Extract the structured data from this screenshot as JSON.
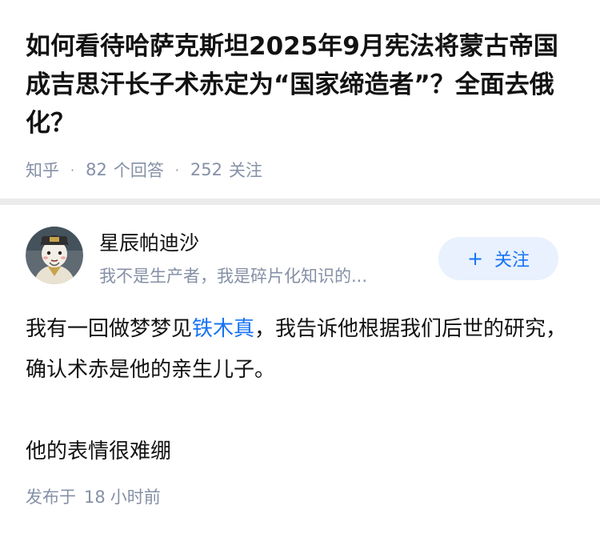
{
  "question": {
    "title": "如何看待哈萨克斯坦2025年9月宪法将蒙古帝国成吉思汗长子术赤定为“国家缔造者”？全面去俄化？",
    "source": "知乎",
    "separator": "·",
    "answers_count": "82",
    "answers_label": "个回答",
    "followers_count": "252",
    "followers_label": "关注"
  },
  "answer": {
    "author": {
      "name": "星辰帕迪沙",
      "bio": "我不是生产者，我是碎片化知识的..."
    },
    "follow_button": {
      "plus": "+",
      "label": "关注"
    },
    "content": {
      "p1_before": "我有一回做梦梦见",
      "p1_link": "铁木真",
      "p1_after": "，我告诉他根据我们后世的研究，确认术赤是他的亲生儿子。",
      "p2": "他的表情很难绷"
    },
    "published": {
      "prefix": "发布于",
      "value": "18",
      "unit": "小时前"
    }
  },
  "colors": {
    "accent": "#1772f6",
    "muted": "#8590a6",
    "follow_bg": "#e8f1fd",
    "divider_bg": "#ebebeb"
  },
  "icons": {
    "avatar": "cartoon-avatar",
    "follow": "plus-icon"
  }
}
